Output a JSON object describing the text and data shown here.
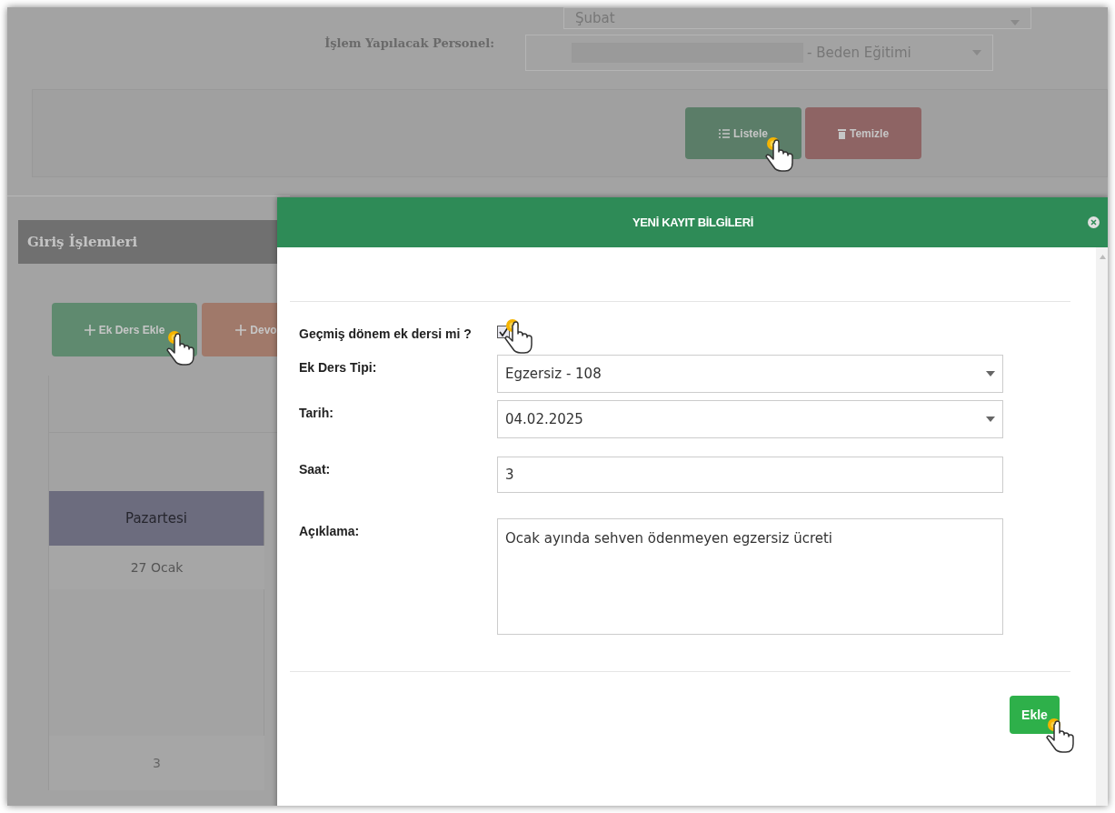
{
  "filter": {
    "month": "Şubat",
    "personnel_label": "İşlem Yapılacak Personel:",
    "personnel_value": "- Beden Eğitimi",
    "buttons": [
      {
        "label": "Listele",
        "kind": "list"
      },
      {
        "label": "Temizle",
        "kind": "clear"
      }
    ]
  },
  "panel": {
    "title": "Giriş İşlemleri",
    "buttons": [
      {
        "label": "Ek Ders Ekle",
        "kind": "green"
      },
      {
        "label": "Devo",
        "kind": "orange"
      }
    ],
    "table": {
      "header": "Pazartesi",
      "date": "27 Ocak",
      "total": "3"
    }
  },
  "modal": {
    "title": "YENİ KAYIT BİLGİLERİ",
    "fields": [
      {
        "kind": "checkbox",
        "label": "Geçmiş dönem ek dersi mi ?",
        "checked": true
      },
      {
        "kind": "select",
        "label": "Ek Ders Tipi:",
        "value": "Egzersiz - 108"
      },
      {
        "kind": "select",
        "label": "Tarih:",
        "value": "04.02.2025"
      },
      {
        "kind": "text",
        "label": "Saat:",
        "value": "3"
      },
      {
        "kind": "textarea",
        "label": "Açıklama:",
        "value": "Ocak ayında sehven ödenmeyen egzersiz ücreti"
      }
    ],
    "submit": "Ekle"
  }
}
